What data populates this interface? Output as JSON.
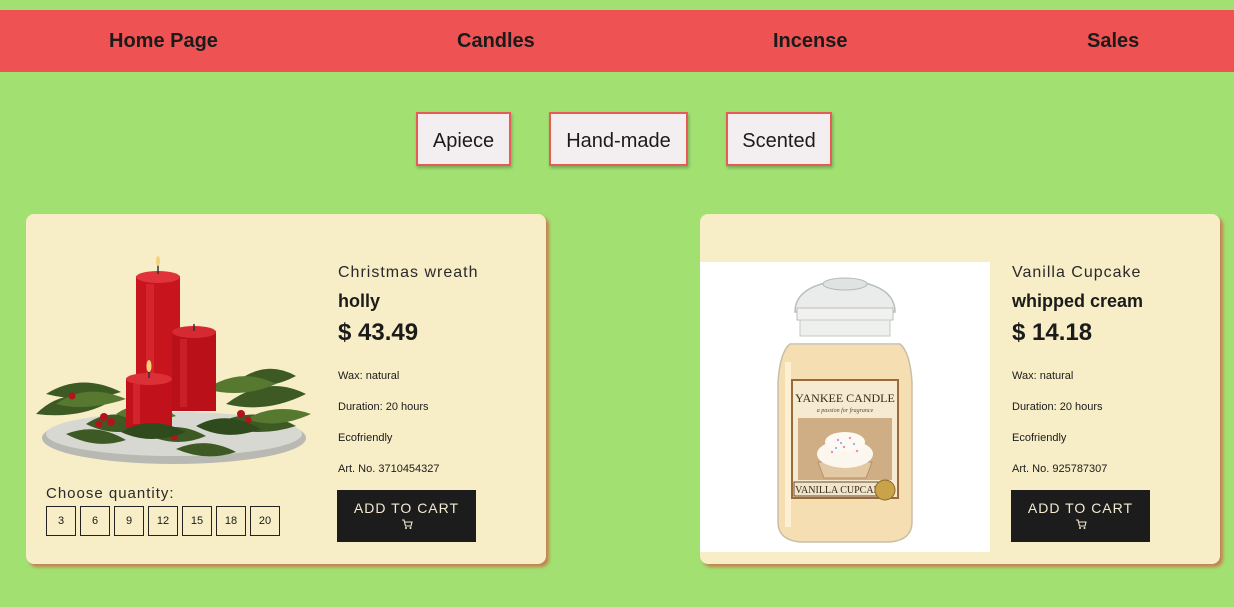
{
  "nav": {
    "items": [
      {
        "label": "Home Page"
      },
      {
        "label": "Candles"
      },
      {
        "label": "Incense"
      },
      {
        "label": "Sales"
      }
    ]
  },
  "filters": [
    {
      "label": "Apiece"
    },
    {
      "label": "Hand-made"
    },
    {
      "label": "Scented"
    }
  ],
  "products": [
    {
      "subtitle": "Christmas wreath",
      "name": "holly",
      "price": "$ 43.49",
      "wax_label": "Wax:",
      "wax_value": "natural",
      "duration_label": "Duration:",
      "duration_value": "20 hours",
      "ecofriendly": "Ecofriendly",
      "art_no": "Art. No. 3710454327",
      "add_to_cart": "ADD TO CART",
      "quantity_label": "Choose quantity:",
      "quantities": [
        "3",
        "6",
        "9",
        "12",
        "15",
        "18",
        "20"
      ]
    },
    {
      "subtitle": "Vanilla Cupcake",
      "name": "whipped cream",
      "price": "$ 14.18",
      "wax_label": "Wax:",
      "wax_value": "natural",
      "duration_label": "Duration:",
      "duration_value": "20 hours",
      "ecofriendly": "Ecofriendly",
      "art_no": "Art. No. 925787307",
      "add_to_cart": "ADD TO CART",
      "jar_brand": "YANKEE CANDLE",
      "jar_tagline": "a passion for fragrance",
      "jar_scent": "VANILLA CUPCAKE"
    }
  ],
  "colors": {
    "background": "#a2e072",
    "nav": "#ef5252",
    "card": "#f7edc6",
    "button": "#1c1c1c"
  },
  "icons": [
    "cart-icon"
  ]
}
